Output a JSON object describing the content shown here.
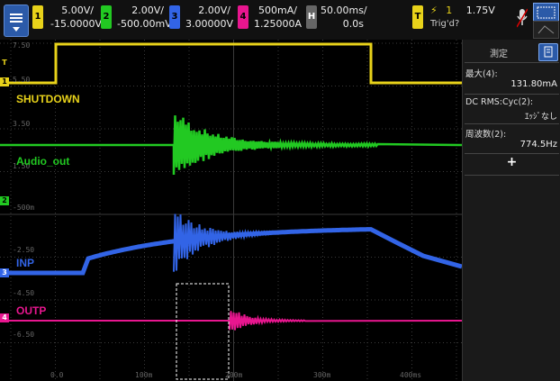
{
  "channels": [
    {
      "num": "1",
      "scale": "5.00V/",
      "offset": "-15.0000V",
      "color": "#e8d21a"
    },
    {
      "num": "2",
      "scale": "2.00V/",
      "offset": "-500.00mV",
      "color": "#22c922"
    },
    {
      "num": "3",
      "scale": "2.00V/",
      "offset": "3.00000V",
      "color": "#3264e6"
    },
    {
      "num": "4",
      "scale": "500mA/",
      "offset": "1.25000A",
      "color": "#e8168f"
    }
  ],
  "horizontal": {
    "label": "H",
    "scale": "50.00ms/",
    "delay": "0.0s"
  },
  "trigger": {
    "label": "T",
    "channel": "1",
    "level": "1.75V",
    "status": "Trig'd?"
  },
  "trace_labels": {
    "ch1": "SHUTDOWN",
    "ch2": "Audio_out",
    "ch3": "INP",
    "ch4": "OUTP"
  },
  "y_ticks": [
    "7.50",
    "5.50",
    "3.50",
    "1.50",
    "-500m",
    "-2.50",
    "-4.50",
    "-6.50"
  ],
  "x_ticks": [
    "0.0",
    "100m",
    "200m",
    "300m",
    "400ms"
  ],
  "markers": {
    "trig_level": "T",
    "ch1": "1",
    "ch2": "2",
    "ch3": "3",
    "ch4": "4"
  },
  "measure_panel": {
    "title": "測定",
    "items": [
      {
        "label": "最大(4):",
        "value": "131.80mA"
      },
      {
        "label": "DC RMS:Cyc(2):",
        "value": "ｴｯｼﾞなし"
      },
      {
        "label": "周波数(2):",
        "value": "774.5Hz"
      }
    ],
    "add_label": "+"
  },
  "colors": {
    "grid": "#3a3a3a",
    "bg": "#000000",
    "panel": "#1a1a1a"
  }
}
